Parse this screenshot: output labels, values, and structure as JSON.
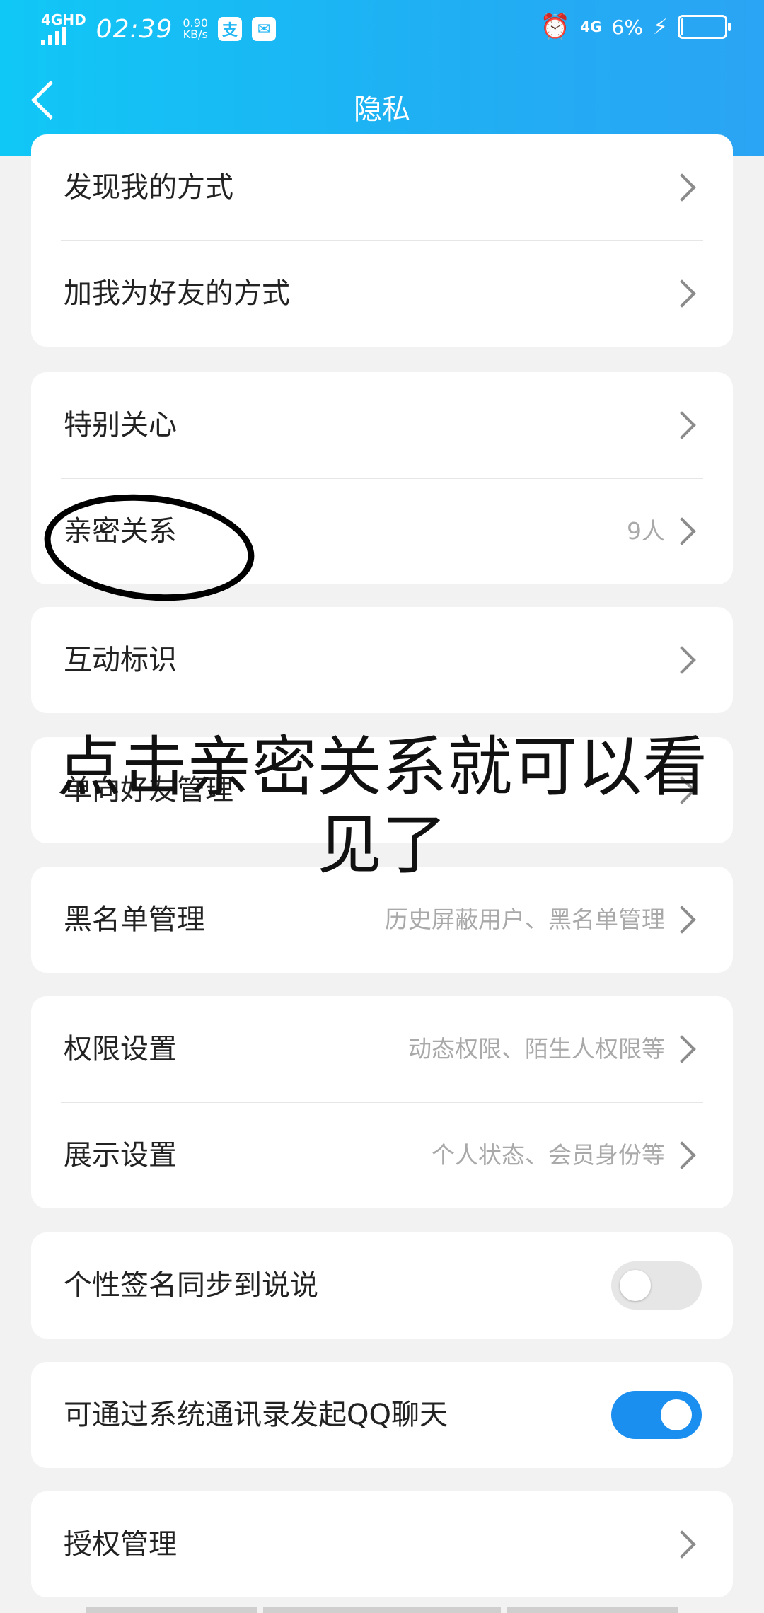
{
  "status_bar": {
    "network": "4GHD",
    "time": "02:39",
    "speed_value": "0.90",
    "speed_unit": "KB/s",
    "alipay_icon_text": "支",
    "right_network": "4G",
    "battery_percent": "6%",
    "battery_level": 0.06
  },
  "header": {
    "title": "隐私"
  },
  "rows": {
    "discover_me": "发现我的方式",
    "add_me": "加我为好友的方式",
    "special_care": "特别关心",
    "intimate": "亲密关系",
    "intimate_count": "9人",
    "interaction_tag": "互动标识",
    "one_way_friend": "单向好友管理",
    "blacklist": "黑名单管理",
    "blacklist_sub": "历史屏蔽用户、黑名单管理",
    "permission": "权限设置",
    "permission_sub": "动态权限、陌生人权限等",
    "display": "展示设置",
    "display_sub": "个人状态、会员身份等",
    "signature_sync": "个性签名同步到说说",
    "contacts_chat": "可通过系统通讯录发起QQ聊天",
    "auth": "授权管理"
  },
  "toggles": {
    "signature_sync": false,
    "contacts_chat": true
  },
  "annotation": {
    "text": "点击亲密关系就可以看见了"
  },
  "colors": {
    "header_start": "#10c8f6",
    "header_end": "#2aa4f4",
    "toggle_on": "#1b8ff0",
    "background": "#f2f2f2"
  }
}
